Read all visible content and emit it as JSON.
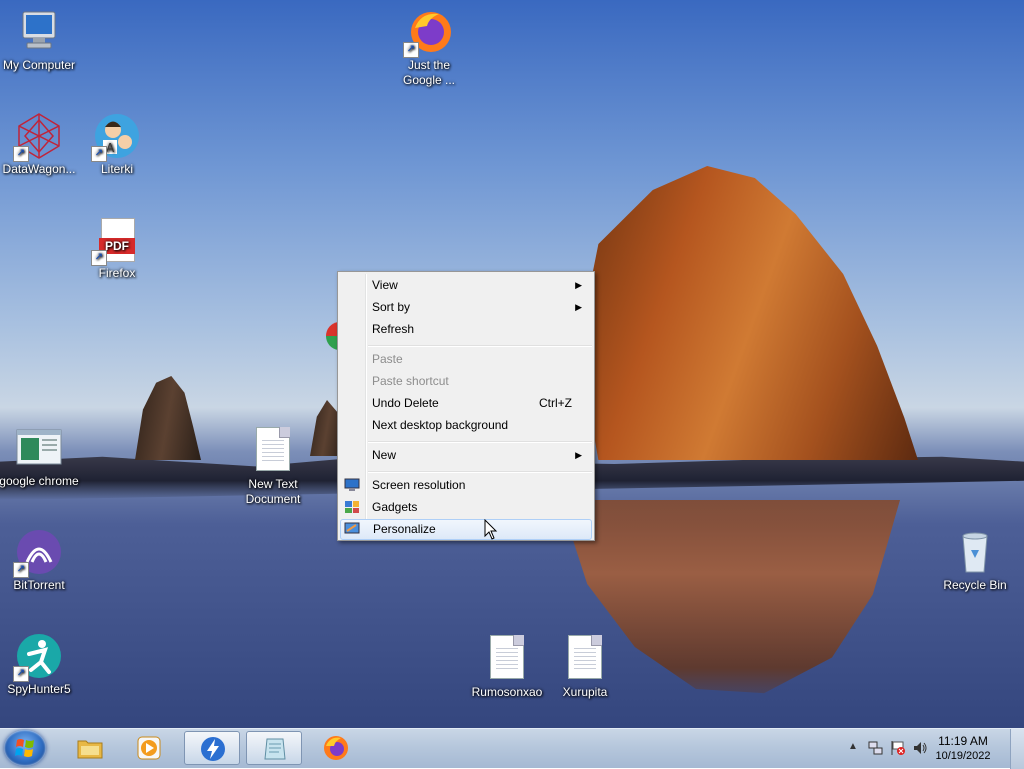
{
  "desktop": {
    "icons": {
      "my_computer": "My Computer",
      "firefox_just": "Just the Google ...",
      "datawagon": "DataWagon...",
      "literki": "Literki",
      "firefox_pdf": "Firefox",
      "google_chrome": "google chrome",
      "new_text_document": "New Text Document",
      "bittorrent": "BitTorrent",
      "recycle_bin": "Recycle Bin",
      "spyhunter": "SpyHunter5",
      "rumosonxao": "Rumosonxao",
      "xurupita": "Xurupita"
    },
    "pdf_badge": "PDF"
  },
  "context_menu": {
    "view": "View",
    "sort_by": "Sort by",
    "refresh": "Refresh",
    "paste": "Paste",
    "paste_shortcut": "Paste shortcut",
    "undo_delete": "Undo Delete",
    "undo_delete_shortcut": "Ctrl+Z",
    "next_background": "Next desktop background",
    "new": "New",
    "screen_resolution": "Screen resolution",
    "gadgets": "Gadgets",
    "personalize": "Personalize"
  },
  "taskbar": {
    "clock_time": "11:19 AM",
    "clock_date": "10/19/2022"
  },
  "icon_names": {
    "start": "windows-start-icon",
    "explorer": "folder-icon",
    "media": "media-player-icon",
    "thunder": "thunder-app-icon",
    "notepad": "notepad-icon",
    "firefox": "firefox-icon"
  }
}
